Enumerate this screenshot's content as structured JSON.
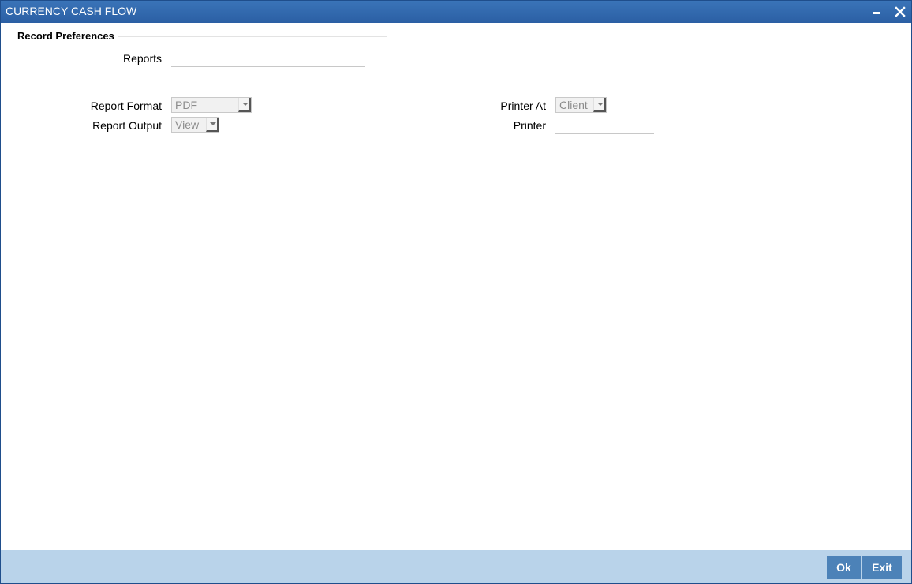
{
  "window": {
    "title": "CURRENCY CASH FLOW"
  },
  "record_preferences": {
    "header": "Record Preferences",
    "reports_label": "Reports",
    "reports_value": "",
    "report_format_label": "Report Format",
    "report_format_value": "PDF",
    "report_output_label": "Report Output",
    "report_output_value": "View",
    "printer_at_label": "Printer At",
    "printer_at_value": "Client",
    "printer_label": "Printer",
    "printer_value": ""
  },
  "footer": {
    "ok_label": "Ok",
    "exit_label": "Exit"
  },
  "icons": {
    "minimize": "minimize-icon",
    "close": "close-icon",
    "dropdown": "chevron-down-icon"
  },
  "colors": {
    "titlebar": "#2f66ab",
    "footer": "#b9d3ea",
    "button": "#4c82b8"
  }
}
